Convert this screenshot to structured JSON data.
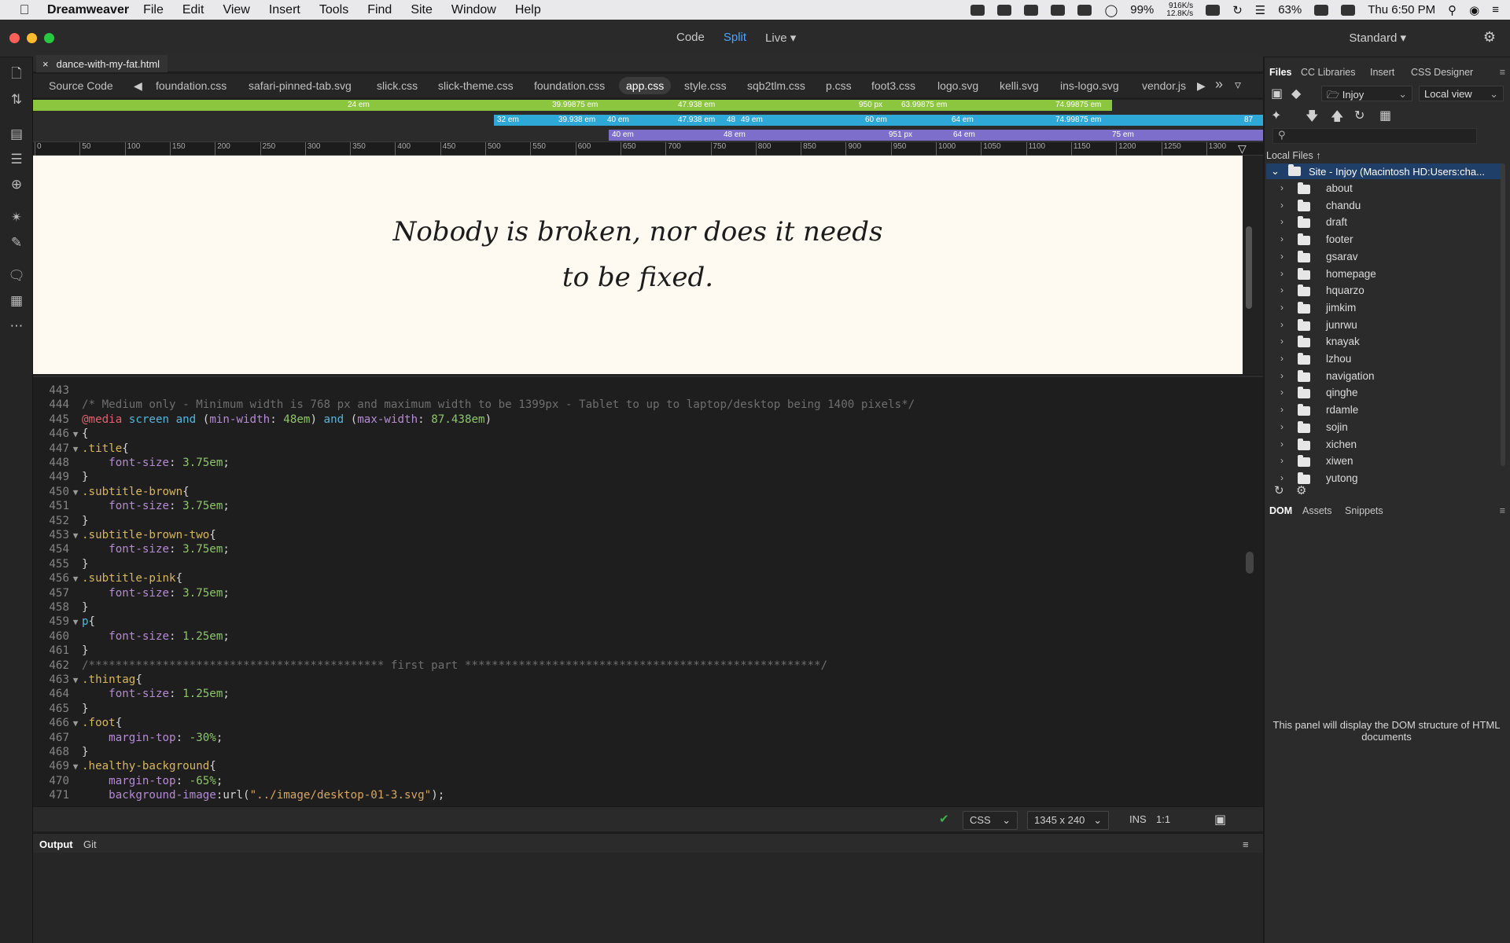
{
  "menubar": {
    "app_name": "Dreamweaver",
    "menus": [
      "File",
      "Edit",
      "View",
      "Insert",
      "Tools",
      "Find",
      "Site",
      "Window",
      "Help"
    ],
    "battery_dark_pct": "99%",
    "net_up": "916K/s",
    "net_down": "12.8K/s",
    "battery_pct": "63%",
    "clock": "Thu 6:50 PM"
  },
  "titlebar": {
    "views": [
      "Code",
      "Split",
      "Live"
    ],
    "active_view": "Split",
    "workspace": "Standard"
  },
  "doc_tab": {
    "filename": "dance-with-my-fat.html",
    "close": "×"
  },
  "related_files": {
    "items": [
      "Source Code",
      "foundation.css",
      "safari-pinned-tab.svg",
      "slick.css",
      "slick-theme.css",
      "foundation.css",
      "app.css",
      "style.css",
      "sqb2tlm.css",
      "p.css",
      "foot3.css",
      "logo.svg",
      "kelli.svg",
      "ins-logo.svg",
      "vendor.js"
    ],
    "active": "app.css",
    "more": "»"
  },
  "media_queries": {
    "row1": [
      "24 em",
      "39.99875 em",
      "47.938 em",
      "950 px",
      "63.99875 em",
      "74.99875 em"
    ],
    "row2": [
      "32 em",
      "39.938 em",
      "40 em",
      "47.938 em",
      "48",
      "49 em",
      "60 em",
      "64 em",
      "74.99875 em",
      "87"
    ],
    "row3": [
      "40 em",
      "48 em",
      "951 px",
      "64 em",
      "75 em"
    ]
  },
  "ruler": [
    "0",
    "50",
    "100",
    "150",
    "200",
    "250",
    "300",
    "350",
    "400",
    "450",
    "500",
    "550",
    "600",
    "650",
    "700",
    "750",
    "800",
    "850",
    "900",
    "950",
    "1000",
    "1050",
    "1100",
    "1150",
    "1200",
    "1250",
    "1300"
  ],
  "live_view": {
    "quote_line1": "Nobody is broken, nor does it needs",
    "quote_line2": "to be fixed."
  },
  "code": {
    "lines": [
      {
        "n": "443",
        "t": ""
      },
      {
        "n": "444",
        "t": "/* Medium only - Minimum width is 768 px and maximum width to be 1399px - Tablet to up to laptop/desktop being 1400 pixels*/"
      },
      {
        "n": "445",
        "t": "@media screen and (min-width: 48em) and (max-width: 87.438em)"
      },
      {
        "n": "446",
        "t": "{"
      },
      {
        "n": "447",
        "t": ".title{"
      },
      {
        "n": "448",
        "t": "    font-size: 3.75em;"
      },
      {
        "n": "449",
        "t": "}"
      },
      {
        "n": "450",
        "t": ".subtitle-brown{"
      },
      {
        "n": "451",
        "t": "    font-size: 3.75em;"
      },
      {
        "n": "452",
        "t": "}"
      },
      {
        "n": "453",
        "t": ".subtitle-brown-two{"
      },
      {
        "n": "454",
        "t": "    font-size: 3.75em;"
      },
      {
        "n": "455",
        "t": "}"
      },
      {
        "n": "456",
        "t": ".subtitle-pink{"
      },
      {
        "n": "457",
        "t": "    font-size: 3.75em;"
      },
      {
        "n": "458",
        "t": "}"
      },
      {
        "n": "459",
        "t": "p{"
      },
      {
        "n": "460",
        "t": "    font-size: 1.25em;"
      },
      {
        "n": "461",
        "t": "}"
      },
      {
        "n": "462",
        "t": "/******************************************** first part *****************************************************/"
      },
      {
        "n": "463",
        "t": ".thintag{"
      },
      {
        "n": "464",
        "t": "    font-size: 1.25em;"
      },
      {
        "n": "465",
        "t": "}"
      },
      {
        "n": "466",
        "t": ".foot{"
      },
      {
        "n": "467",
        "t": "    margin-top: -30%;"
      },
      {
        "n": "468",
        "t": "}"
      },
      {
        "n": "469",
        "t": ".healthy-background{"
      },
      {
        "n": "470",
        "t": "    margin-top: -65%;"
      },
      {
        "n": "471",
        "t": "    background-image:url(\"../image/desktop-01-3.svg\");"
      }
    ]
  },
  "statusbar": {
    "language": "CSS",
    "dimensions": "1345 x 240",
    "mode": "INS",
    "position": "1:1"
  },
  "output_panel": {
    "tabs": [
      "Output",
      "Git"
    ],
    "active": "Output"
  },
  "right_panel": {
    "top_tabs": [
      "Files",
      "CC Libraries",
      "Insert",
      "CSS Designer"
    ],
    "active_top_tab": "Files",
    "site_select": "Injoy",
    "view_select": "Local view",
    "local_files_label": "Local Files",
    "site_root": "Site - Injoy (Macintosh HD:Users:cha...",
    "folders": [
      "about",
      "chandu",
      "draft",
      "footer",
      "gsarav",
      "homepage",
      "hquarzo",
      "jimkim",
      "junrwu",
      "knayak",
      "lzhou",
      "navigation",
      "qinghe",
      "rdamle",
      "sojin",
      "xichen",
      "xiwen",
      "yutong"
    ],
    "bottom_tabs": [
      "DOM",
      "Assets",
      "Snippets"
    ],
    "active_bottom_tab": "DOM",
    "dom_message": "This panel will display the DOM structure of HTML documents"
  },
  "colors": {
    "accent_blue": "#4aa3ff",
    "mq_green": "#8cc63e",
    "mq_blue": "#2ea8d6",
    "mq_purple": "#7d6ecb",
    "selection": "#1f3e68"
  }
}
